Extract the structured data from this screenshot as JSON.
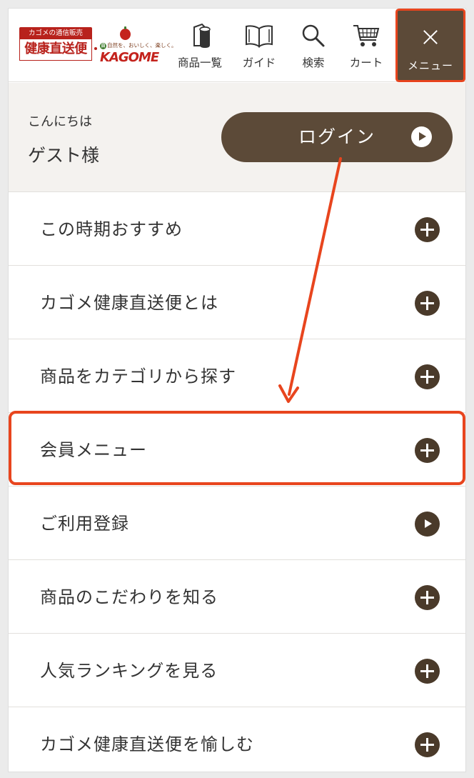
{
  "header": {
    "logo_top": "カゴメの通信販売",
    "logo_main": "健康直送便",
    "kagome_tagline": "自然を、おいしく、楽しく。",
    "kagome_word": "KAGOME",
    "nav": [
      {
        "label": "商品一覧",
        "icon": "products-icon"
      },
      {
        "label": "ガイド",
        "icon": "book-icon"
      },
      {
        "label": "検索",
        "icon": "search-icon"
      },
      {
        "label": "カート",
        "icon": "cart-icon"
      }
    ],
    "menu_label": "メニュー"
  },
  "greeting": {
    "hello": "こんにちは",
    "guest": "ゲスト様",
    "login_label": "ログイン"
  },
  "menu_items": [
    {
      "label": "この時期おすすめ",
      "icon": "plus-circle-icon"
    },
    {
      "label": "カゴメ健康直送便とは",
      "icon": "plus-circle-icon"
    },
    {
      "label": "商品をカテゴリから探す",
      "icon": "plus-circle-icon"
    },
    {
      "label": "会員メニュー",
      "icon": "plus-circle-icon"
    },
    {
      "label": "ご利用登録",
      "icon": "play-circle-icon"
    },
    {
      "label": "商品のこだわりを知る",
      "icon": "plus-circle-icon"
    },
    {
      "label": "人気ランキングを見る",
      "icon": "plus-circle-icon"
    },
    {
      "label": "カゴメ健康直送便を愉しむ",
      "icon": "plus-circle-icon"
    }
  ],
  "colors": {
    "brand_brown": "#5c4a38",
    "icon_brown": "#4a3a2a",
    "highlight_orange": "#e8451e",
    "brand_red": "#b8221c"
  }
}
